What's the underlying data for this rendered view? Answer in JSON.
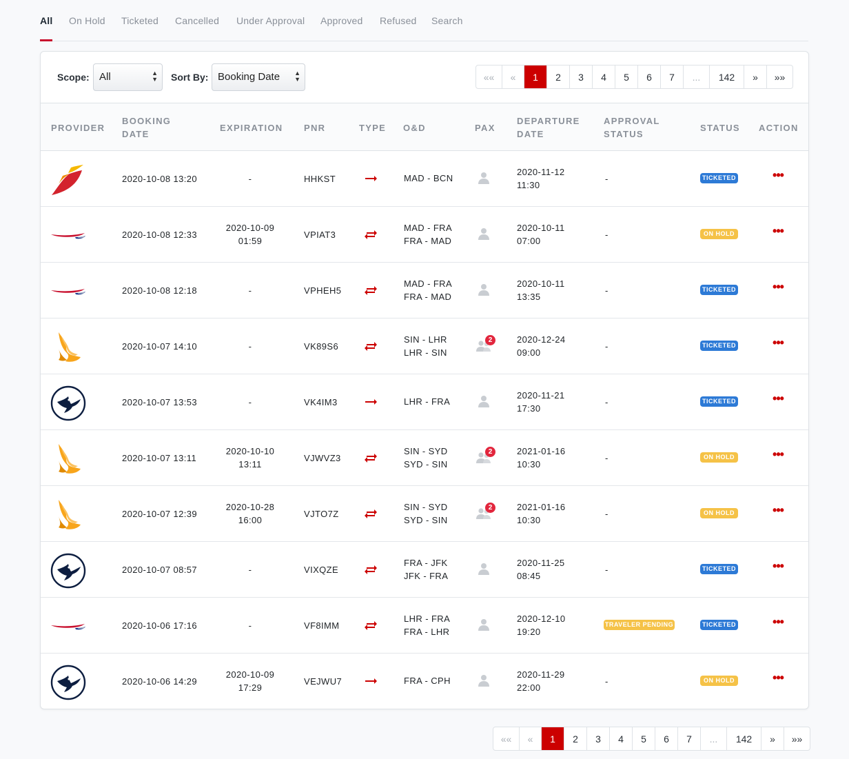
{
  "tabs": [
    "All",
    "On Hold",
    "Ticketed",
    "Cancelled",
    "Under Approval",
    "Approved",
    "Refused",
    "Search"
  ],
  "filters": {
    "scope_label": "Scope:",
    "scope_value": "All",
    "sort_label": "Sort By:",
    "sort_value": "Booking Date"
  },
  "pagination": {
    "first": "««",
    "prev": "«",
    "pages": [
      "1",
      "2",
      "3",
      "4",
      "5",
      "6",
      "7"
    ],
    "ellipsis": "...",
    "last_page": "142",
    "next": "»",
    "last": "»»",
    "current": "1"
  },
  "columns": {
    "provider": "PROVIDER",
    "booking_date": "BOOKING DATE",
    "expiration": "EXPIRATION",
    "pnr": "PNR",
    "type": "TYPE",
    "od": "O&D",
    "pax": "PAX",
    "departure_date": "DEPARTURE DATE",
    "approval_status": "APPROVAL STATUS",
    "status": "STATUS",
    "action": "ACTION"
  },
  "colors": {
    "accent": "#cc0000",
    "ticketed": "#2d7ad6",
    "on_hold": "#f5c247",
    "traveler_pending": "#f5c247",
    "pax_badge": "#e2263d"
  },
  "rows": [
    {
      "provider": "iberia-logo",
      "booking_date": "2020-10-08 13:20",
      "expiration": [
        "-"
      ],
      "pnr": "HHKST",
      "type": "one-way-arrow-icon",
      "od": [
        "MAD - BCN"
      ],
      "pax": "",
      "departure": [
        "2020-11-12",
        "11:30"
      ],
      "approval": "-",
      "approval_badge": "",
      "status": "TICKETED"
    },
    {
      "provider": "british-airways-logo",
      "booking_date": "2020-10-08 12:33",
      "expiration": [
        "2020-10-09",
        "01:59"
      ],
      "pnr": "VPIAT3",
      "type": "round-trip-arrows-icon",
      "od": [
        "MAD - FRA",
        "FRA - MAD"
      ],
      "pax": "",
      "departure": [
        "2020-10-11",
        "07:00"
      ],
      "approval": "-",
      "approval_badge": "",
      "status": "ON HOLD"
    },
    {
      "provider": "british-airways-logo",
      "booking_date": "2020-10-08 12:18",
      "expiration": [
        "-"
      ],
      "pnr": "VPHEH5",
      "type": "round-trip-arrows-icon",
      "od": [
        "MAD - FRA",
        "FRA - MAD"
      ],
      "pax": "",
      "departure": [
        "2020-10-11",
        "13:35"
      ],
      "approval": "-",
      "approval_badge": "",
      "status": "TICKETED"
    },
    {
      "provider": "singapore-airlines-logo",
      "booking_date": "2020-10-07 14:10",
      "expiration": [
        "-"
      ],
      "pnr": "VK89S6",
      "type": "round-trip-arrows-icon",
      "od": [
        "SIN - LHR",
        "LHR - SIN"
      ],
      "pax": "2",
      "departure": [
        "2020-12-24",
        "09:00"
      ],
      "approval": "-",
      "approval_badge": "",
      "status": "TICKETED"
    },
    {
      "provider": "lufthansa-logo",
      "booking_date": "2020-10-07 13:53",
      "expiration": [
        "-"
      ],
      "pnr": "VK4IM3",
      "type": "one-way-arrow-icon",
      "od": [
        "LHR - FRA"
      ],
      "pax": "",
      "departure": [
        "2020-11-21",
        "17:30"
      ],
      "approval": "-",
      "approval_badge": "",
      "status": "TICKETED"
    },
    {
      "provider": "singapore-airlines-logo",
      "booking_date": "2020-10-07 13:11",
      "expiration": [
        "2020-10-10",
        "13:11"
      ],
      "pnr": "VJWVZ3",
      "type": "round-trip-arrows-icon",
      "od": [
        "SIN - SYD",
        "SYD - SIN"
      ],
      "pax": "2",
      "departure": [
        "2021-01-16",
        "10:30"
      ],
      "approval": "-",
      "approval_badge": "",
      "status": "ON HOLD"
    },
    {
      "provider": "singapore-airlines-logo",
      "booking_date": "2020-10-07 12:39",
      "expiration": [
        "2020-10-28",
        "16:00"
      ],
      "pnr": "VJTO7Z",
      "type": "round-trip-arrows-icon",
      "od": [
        "SIN - SYD",
        "SYD - SIN"
      ],
      "pax": "2",
      "departure": [
        "2021-01-16",
        "10:30"
      ],
      "approval": "-",
      "approval_badge": "",
      "status": "ON HOLD"
    },
    {
      "provider": "lufthansa-logo",
      "booking_date": "2020-10-07 08:57",
      "expiration": [
        "-"
      ],
      "pnr": "VIXQZE",
      "type": "round-trip-arrows-icon",
      "od": [
        "FRA - JFK",
        "JFK - FRA"
      ],
      "pax": "",
      "departure": [
        "2020-11-25",
        "08:45"
      ],
      "approval": "-",
      "approval_badge": "",
      "status": "TICKETED"
    },
    {
      "provider": "british-airways-logo",
      "booking_date": "2020-10-06 17:16",
      "expiration": [
        "-"
      ],
      "pnr": "VF8IMM",
      "type": "round-trip-arrows-icon",
      "od": [
        "LHR - FRA",
        "FRA - LHR"
      ],
      "pax": "",
      "departure": [
        "2020-12-10",
        "19:20"
      ],
      "approval": "",
      "approval_badge": "TRAVELER PENDING",
      "status": "TICKETED"
    },
    {
      "provider": "lufthansa-logo",
      "booking_date": "2020-10-06 14:29",
      "expiration": [
        "2020-10-09",
        "17:29"
      ],
      "pnr": "VEJWU7",
      "type": "one-way-arrow-icon",
      "od": [
        "FRA - CPH"
      ],
      "pax": "",
      "departure": [
        "2020-11-29",
        "22:00"
      ],
      "approval": "-",
      "approval_badge": "",
      "status": "ON HOLD"
    }
  ]
}
